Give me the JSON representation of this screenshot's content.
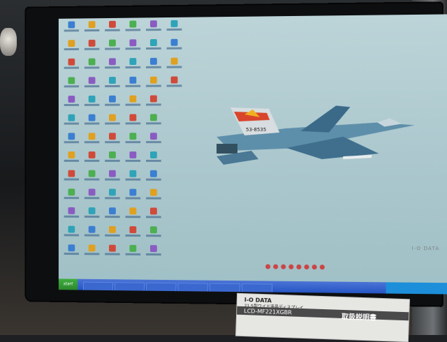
{
  "scene": {
    "description_hidden": "",
    "jet_tail_number": "53-8535",
    "monitor_brand": "I-O DATA",
    "manual": {
      "brand": "I-O DATA",
      "subtitle": "21.5型ワイド液晶ディスプレイ",
      "model": "LCD-MF221XGBR",
      "title": "取扱説明書"
    },
    "taskbar": {
      "start_label": "start"
    }
  }
}
